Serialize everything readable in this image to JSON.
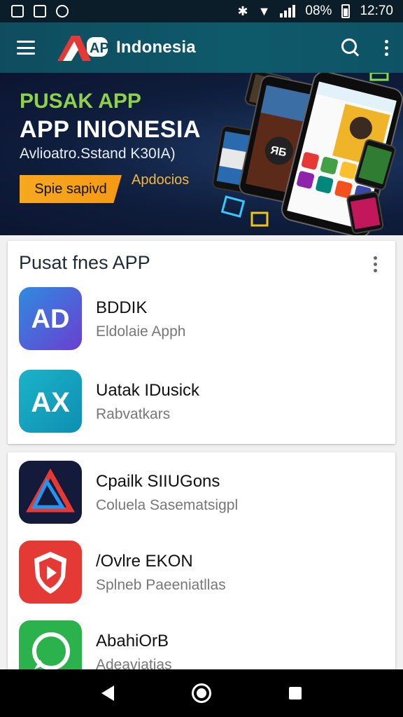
{
  "status_bar": {
    "battery": "08%",
    "time": "12:70"
  },
  "app_bar": {
    "title": "Indonesia",
    "logo_text": "APP"
  },
  "banner": {
    "line1": "PUSAK APP",
    "line2": "APP INIONESIA",
    "line3": "Avlioatro.Sstand K30IA)",
    "cta_label": "Spie sapivd",
    "link_label": "Apdocios",
    "phone_badge": "ЯБ"
  },
  "card1": {
    "title": "Pusat fnes APP",
    "apps": [
      {
        "name": "BDDIK",
        "subtitle": "Eldolaie Apph",
        "icon": "ad-logo-icon",
        "icon_text": "AD"
      },
      {
        "name": "Uatak IDusick",
        "subtitle": "Rabvatkars",
        "icon": "ax-logo-icon",
        "icon_text": "AX"
      }
    ]
  },
  "card2": {
    "apps": [
      {
        "name": "Cpailk SIIUGons",
        "subtitle": "Coluela Sasematsigpl",
        "icon": "triangle-logo-icon"
      },
      {
        "name": "/Ovlre EKON",
        "subtitle": "Splneb Paeeniatllas",
        "icon": "shield-play-icon"
      },
      {
        "name": "AbahiOrB",
        "subtitle": "Adeaviatias",
        "icon": "chat-bubble-icon"
      }
    ]
  },
  "colors": {
    "app_bar": "#0f4c5f",
    "banner_green": "#8fd14a",
    "cta_orange": "#f7a81f"
  }
}
